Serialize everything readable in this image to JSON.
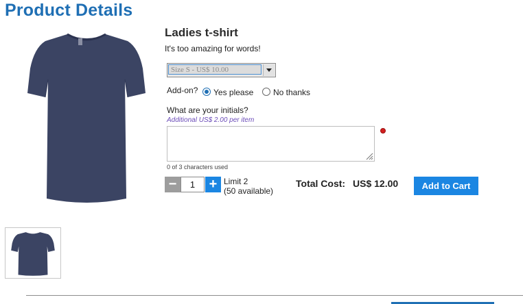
{
  "page": {
    "title": "Product Details"
  },
  "product": {
    "name": "Ladies t-shirt",
    "tagline": "It's too amazing for words!",
    "image_icon": "navy-tshirt-image",
    "color": "#3b4463"
  },
  "options": {
    "size": {
      "selected": "Size S  - US$ 10.00"
    },
    "addon": {
      "label": "Add-on?",
      "yes_label": "Yes please",
      "no_label": "No thanks",
      "selected": "yes"
    },
    "initials": {
      "label": "What are your initials?",
      "price_note": "Additional US$ 2.00 per item",
      "value": "",
      "char_count": "0 of 3 characters used"
    }
  },
  "quantity": {
    "minus": "−",
    "value": "1",
    "plus": "+",
    "limit_line1": "Limit 2",
    "limit_line2": "(50 available)"
  },
  "total": {
    "label": "Total Cost:",
    "value": "US$ 12.00"
  },
  "actions": {
    "add_to_cart": "Add to Cart"
  },
  "colors": {
    "title_blue": "#1f6fb4",
    "button_blue": "#1b86e2",
    "required_red": "#d21f1f"
  }
}
